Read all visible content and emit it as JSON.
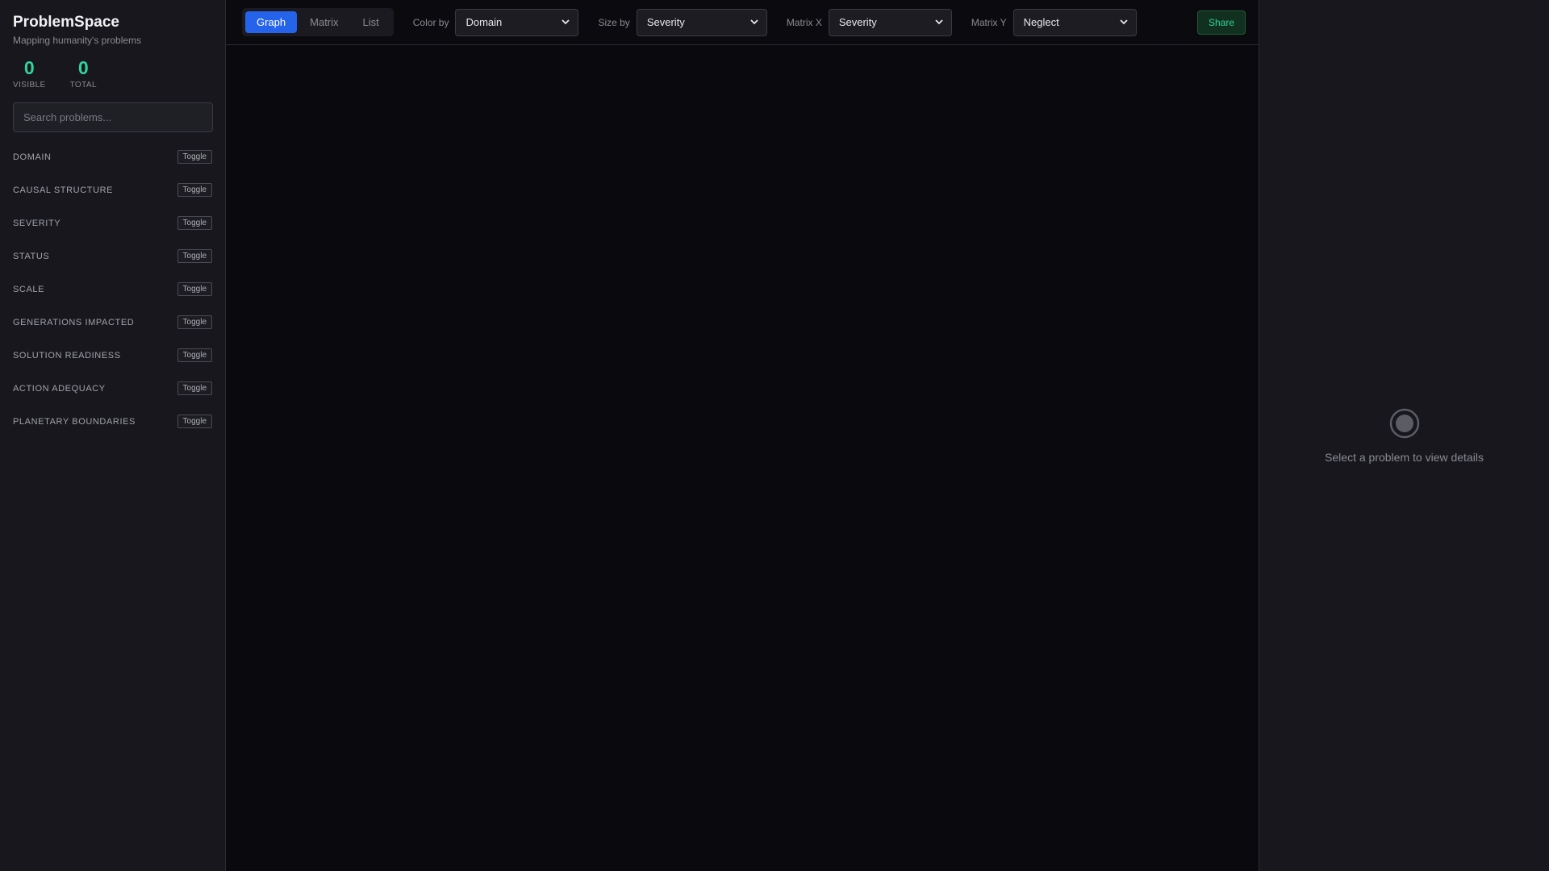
{
  "sidebar": {
    "title": "ProblemSpace",
    "subtitle": "Mapping humanity's problems",
    "stats": [
      {
        "value": "0",
        "label": "VISIBLE"
      },
      {
        "value": "0",
        "label": "TOTAL"
      }
    ],
    "search_placeholder": "Search problems...",
    "toggle_label": "Toggle",
    "filters": [
      "DOMAIN",
      "CAUSAL STRUCTURE",
      "SEVERITY",
      "STATUS",
      "SCALE",
      "GENERATIONS IMPACTED",
      "SOLUTION READINESS",
      "ACTION ADEQUACY",
      "PLANETARY BOUNDARIES"
    ]
  },
  "toolbar": {
    "tabs": [
      "Graph",
      "Matrix",
      "List"
    ],
    "active_tab": "Graph",
    "color_by": {
      "label": "Color by",
      "value": "Domain"
    },
    "size_by": {
      "label": "Size by",
      "value": "Severity"
    },
    "matrix_x": {
      "label": "Matrix X",
      "value": "Severity"
    },
    "matrix_y": {
      "label": "Matrix Y",
      "value": "Neglect"
    },
    "share_label": "Share"
  },
  "details": {
    "empty_text": "Select a problem to view details",
    "icon": "target-icon"
  },
  "colors": {
    "accent": "#2563eb",
    "stat_green": "#34d39a",
    "background": "#0b0b0f",
    "panel": "#17171d"
  }
}
